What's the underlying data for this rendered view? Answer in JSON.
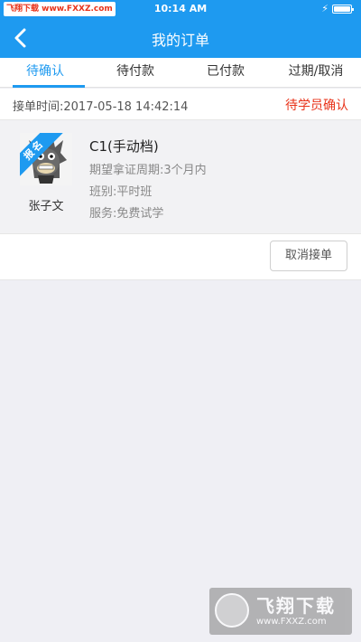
{
  "status_bar": {
    "watermark": "飞翔下载 www.FXXZ.com",
    "time": "10:14 AM"
  },
  "nav": {
    "title": "我的订单",
    "back_icon": "chevron-left-icon"
  },
  "tabs": [
    {
      "label": "待确认",
      "active": true
    },
    {
      "label": "待付款",
      "active": false
    },
    {
      "label": "已付款",
      "active": false
    },
    {
      "label": "过期/取消",
      "active": false
    }
  ],
  "order": {
    "time_label": "接单时间:2017-05-18 14:42:14",
    "status": "待学员确认",
    "ribbon": "报名",
    "student_name": "张子文",
    "course": "C1(手动档)",
    "period": "期望拿证周期:3个月内",
    "class_type": "班别:平时班",
    "service": "服务:免费试学",
    "cancel_button": "取消接单"
  },
  "watermark_bottom": {
    "brand": "飞翔下载",
    "url": "www.FXXZ.com"
  },
  "colors": {
    "primary": "#1e9af0",
    "status_red": "#e8331a"
  }
}
